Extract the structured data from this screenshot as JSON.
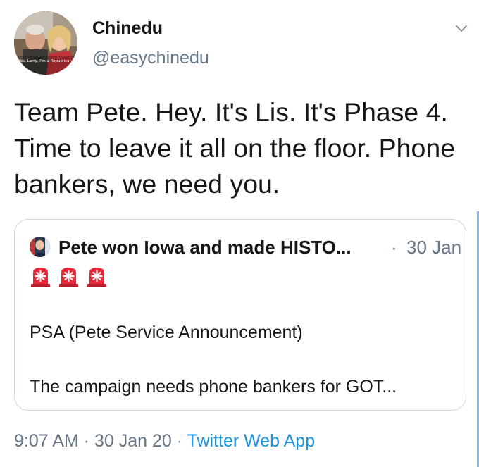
{
  "author": {
    "display_name": "Chinedu",
    "handle": "@easychinedu",
    "avatar_caption": "Yes, Larry, I'm a Republican."
  },
  "tweet": {
    "text": "Team Pete. Hey. It's Lis. It's Phase 4. Time to leave it all on the floor. Phone bankers, we need you."
  },
  "quoted": {
    "display_name": "Pete won Iowa and made HISTO...",
    "separator": "·",
    "date": "30 Jan",
    "emoji": [
      "police-light-icon",
      "police-light-icon",
      "police-light-icon"
    ],
    "line1": "PSA (Pete Service Announcement)",
    "line2": "The campaign needs phone bankers for GOT..."
  },
  "meta": {
    "time": "9:07 AM",
    "sep1": " · ",
    "date": "30 Jan 20",
    "sep2": " · ",
    "app": "Twitter Web App"
  },
  "colors": {
    "text": "#14171a",
    "secondary": "#657786",
    "link": "#1b95e0",
    "border": "#ccd6dd"
  }
}
